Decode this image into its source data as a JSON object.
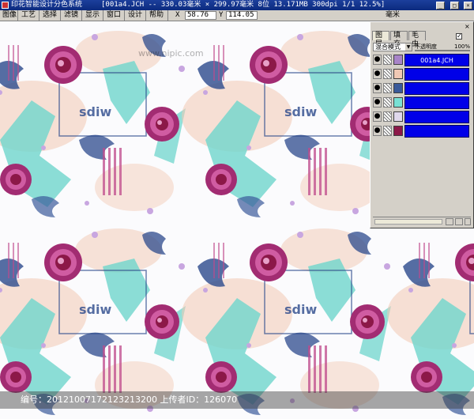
{
  "window": {
    "app_title": "印花智能设计分色系统",
    "document_info": "[001a4.JCH -- 330.03毫米 × 299.97毫米 8位 13.171MB 300dpi 1/1 12.5%]"
  },
  "menu": {
    "items": [
      "图像",
      "工艺",
      "选择",
      "滤镜",
      "显示",
      "窗口",
      "设计",
      "帮助"
    ]
  },
  "status": {
    "x_label": "X",
    "x_value": "58.76",
    "y_label": "Y",
    "y_value": "114.05",
    "unit": "毫米"
  },
  "layer_panel": {
    "tabs": [
      "图层",
      "填充",
      "毛虫"
    ],
    "active_tab": 0,
    "blend_mode": "混合模式",
    "opacity_label": "不透明度",
    "opacity_value": "100%",
    "layers": [
      {
        "name": "001a4.JCH",
        "swatch": "#a884c8"
      },
      {
        "name": "",
        "swatch": "#f0c8b4"
      },
      {
        "name": "",
        "swatch": "#3a5a9a"
      },
      {
        "name": "",
        "swatch": "#78e0d4"
      },
      {
        "name": "",
        "swatch": "#e0d8ec"
      },
      {
        "name": "",
        "swatch": "#8c1848"
      }
    ]
  },
  "watermark": {
    "text": "编号：20121007172123213200 上传者ID：126070",
    "site": "www.nipic.com"
  },
  "colors": {
    "rose": "#b23a80",
    "navy": "#2c4a8c",
    "teal": "#6fd6cc",
    "peach": "#f2c8b2",
    "lilac": "#c8a6e0",
    "selection": "#0000e8"
  }
}
